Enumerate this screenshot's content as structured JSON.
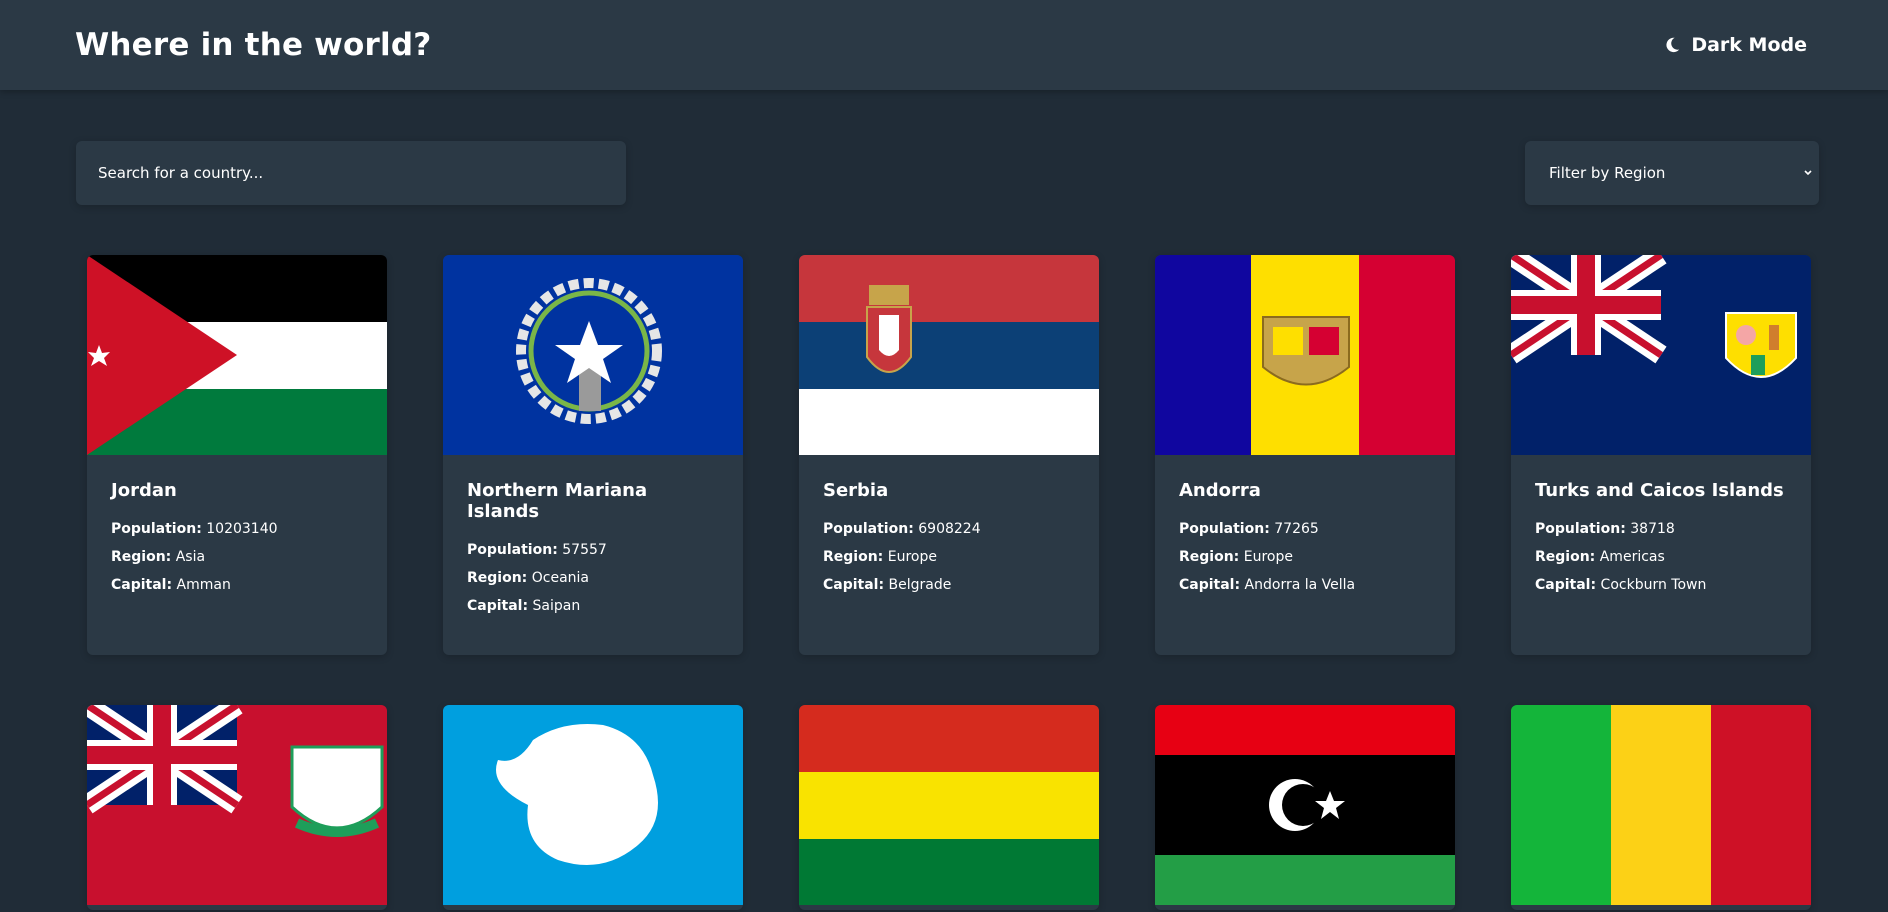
{
  "header": {
    "title": "Where in the world?",
    "mode_label": "Dark Mode",
    "mode_icon": "moon-icon"
  },
  "search": {
    "placeholder": "Search for a country..."
  },
  "filter": {
    "label": "Filter by Region"
  },
  "labels": {
    "population": "Population:",
    "region": "Region:",
    "capital": "Capital:"
  },
  "countries": [
    {
      "name": "Jordan",
      "population": "10203140",
      "region": "Asia",
      "capital": "Amman"
    },
    {
      "name": "Northern Mariana Islands",
      "population": "57557",
      "region": "Oceania",
      "capital": "Saipan"
    },
    {
      "name": "Serbia",
      "population": "6908224",
      "region": "Europe",
      "capital": "Belgrade"
    },
    {
      "name": "Andorra",
      "population": "77265",
      "region": "Europe",
      "capital": "Andorra la Vella"
    },
    {
      "name": "Turks and Caicos Islands",
      "population": "38718",
      "region": "Americas",
      "capital": "Cockburn Town"
    }
  ],
  "colors": {
    "background": "#202c37",
    "element": "#2b3945",
    "text": "#ffffff"
  }
}
